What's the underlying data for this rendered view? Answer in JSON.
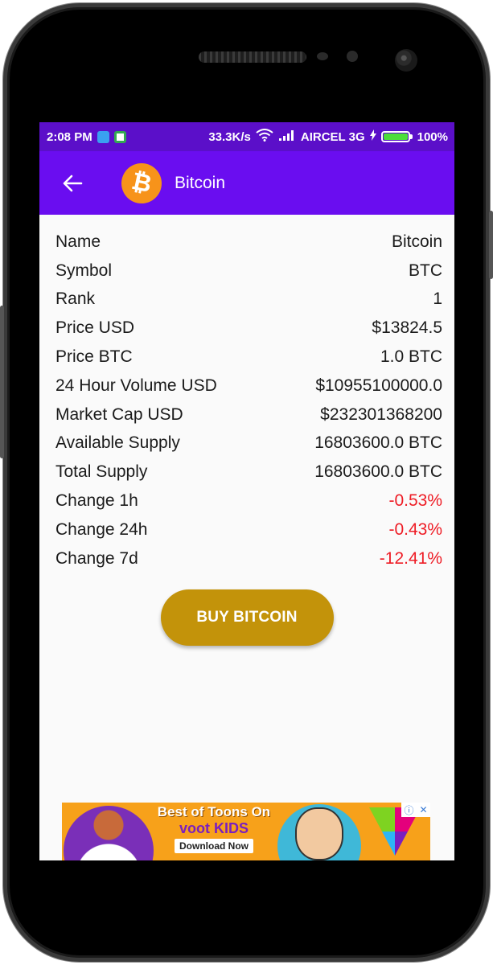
{
  "status_bar": {
    "time": "2:08 PM",
    "network_speed": "33.3K/s",
    "carrier": "AIRCEL 3G",
    "battery": "100%"
  },
  "app_bar": {
    "title": "Bitcoin",
    "back_icon": "arrow-back-icon",
    "coin_icon": "bitcoin-icon"
  },
  "details": [
    {
      "label": "Name",
      "value": "Bitcoin",
      "negative": false
    },
    {
      "label": "Symbol",
      "value": "BTC",
      "negative": false
    },
    {
      "label": "Rank",
      "value": "1",
      "negative": false
    },
    {
      "label": "Price USD",
      "value": "$13824.5",
      "negative": false
    },
    {
      "label": "Price BTC",
      "value": "1.0 BTC",
      "negative": false
    },
    {
      "label": "24 Hour Volume USD",
      "value": "$10955100000.0",
      "negative": false
    },
    {
      "label": "Market Cap USD",
      "value": "$232301368200",
      "negative": false
    },
    {
      "label": "Available Supply",
      "value": "16803600.0 BTC",
      "negative": false
    },
    {
      "label": "Total Supply",
      "value": "16803600.0 BTC",
      "negative": false
    },
    {
      "label": "Change 1h",
      "value": "-0.53%",
      "negative": true
    },
    {
      "label": "Change 24h",
      "value": "-0.43%",
      "negative": true
    },
    {
      "label": "Change 7d",
      "value": "-12.41%",
      "negative": true
    }
  ],
  "buy_button": {
    "label": "BUY BITCOIN"
  },
  "ad": {
    "line1": "Best of Toons On",
    "line2": "voot KIDS",
    "cta": "Download Now"
  },
  "colors": {
    "status_bar": "#5b0fc9",
    "app_bar": "#6a0df0",
    "negative": "#ee1c25",
    "buy_button": "#c3930a",
    "coin": "#f7931a"
  }
}
